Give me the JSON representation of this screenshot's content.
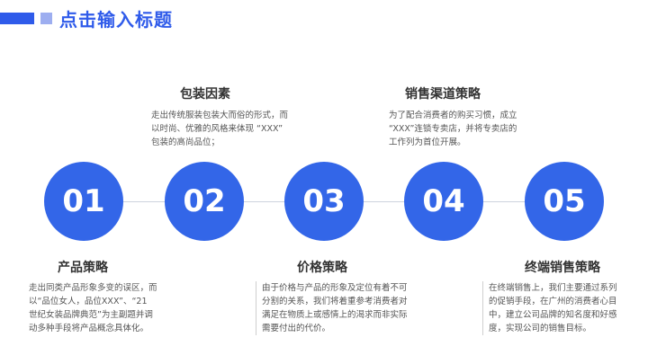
{
  "page": {
    "title": "点击输入标题"
  },
  "steps": [
    {
      "number": "01",
      "heading": "产品策略",
      "lines": [
        "走出同类产品形象多变的误区，而",
        "以“品位女人，品位XXX”、“21",
        "世纪女装品牌典范”为主副题并调",
        "动多种手段将产品概念具体化。"
      ]
    },
    {
      "number": "02",
      "heading": "包装因素",
      "lines": [
        "走出传统服装包装大而俗的形式，而",
        "以时尚、优雅的风格来体现 “XXX”",
        "包装的高尚品位；"
      ]
    },
    {
      "number": "03",
      "heading": "价格策略",
      "lines": [
        "由于价格与产品的形象及定位有着不可",
        "分割的关系，我们将着重参考消费者对",
        "满足在物质上或感情上的渴求而非实际",
        "需要付出的代价。"
      ]
    },
    {
      "number": "04",
      "heading": "销售渠道策略",
      "lines": [
        "为了配合消费者的购买习惯，成立",
        "“XXX”连锁专卖店，并将专卖店的",
        "工作列为首位开展。"
      ]
    },
    {
      "number": "05",
      "heading": "终端销售策略",
      "lines": [
        "在终端销售上，我们主要通过系列",
        "的促销手段，在广州的消费者心目",
        "中，建立公司品牌的知名度和好感",
        "度，实现公司的销售目标。"
      ]
    }
  ],
  "colors": {
    "primary": "#2F5BEA",
    "circle": "#3366E8",
    "accent_light": "#9DAEF0"
  }
}
